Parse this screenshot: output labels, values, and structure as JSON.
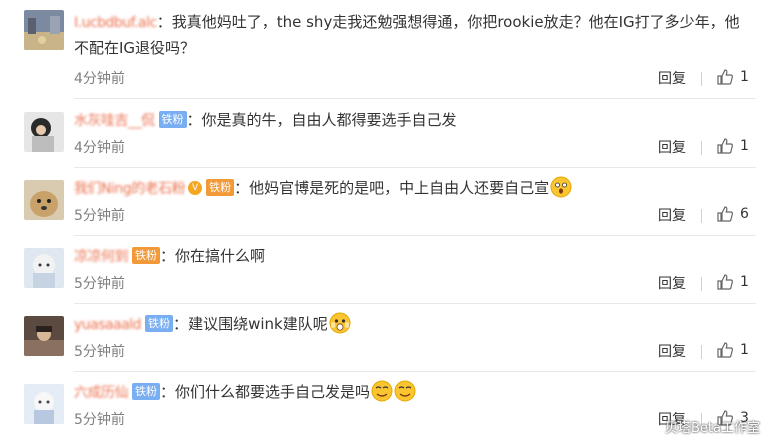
{
  "reply_label": "回复",
  "comments": [
    {
      "username": "I.ucbdbuf.alc",
      "badge": "",
      "text": "我真他妈吐了，the shy走我还勉强想得通，你把rookie放走？他在IG打了多少年，他不配在IG退役吗？",
      "time": "4分钟前",
      "likes": "1",
      "emoji": ""
    },
    {
      "username": "水灰哇吉__侃",
      "badge": "铁粉",
      "text": "你是真的牛，自由人都得要选手自己发",
      "time": "4分钟前",
      "likes": "1",
      "emoji": ""
    },
    {
      "username": "我们Ning的老石粉",
      "badge": "铁粉",
      "text": "他妈官博是死的是吧，中上自由人还要自己宣",
      "time": "5分钟前",
      "likes": "6",
      "emoji": "shocked-emoji"
    },
    {
      "username": "凉凉何到",
      "badge": "铁粉",
      "text": "你在搞什么啊",
      "time": "5分钟前",
      "likes": "1",
      "emoji": ""
    },
    {
      "username": "yuasaaald",
      "badge": "铁粉",
      "text": "建议围绕wink建队呢",
      "time": "5分钟前",
      "likes": "1",
      "emoji": "scared-emoji"
    },
    {
      "username": "六成历仙",
      "badge": "铁粉",
      "text": "你们什么都要选手自己发是吗",
      "time": "5分钟前",
      "likes": "3",
      "emoji": "dizzy-emoji"
    }
  ],
  "watermark": "贝塔Beta工作室",
  "colors": {
    "username": "#eb7350",
    "badge": "#7aaef2",
    "vip_badge": "#f29a38",
    "time": "#808080"
  }
}
